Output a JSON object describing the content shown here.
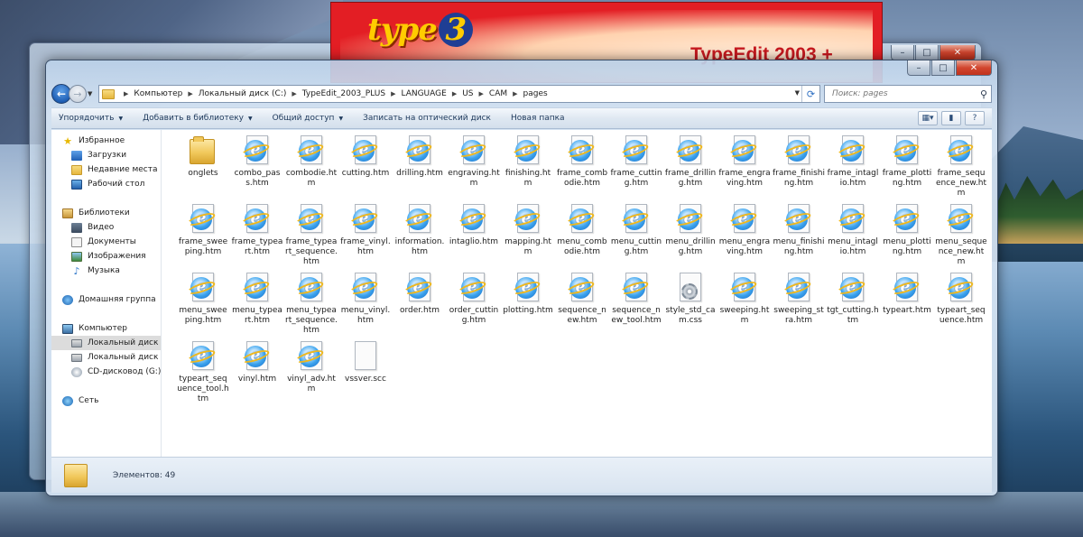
{
  "splash": {
    "logo_text": "type",
    "logo_number": "3",
    "product_title": "TypeEdit 2003 +"
  },
  "address": {
    "crumbs": [
      "Компьютер",
      "Локальный диск (C:)",
      "TypeEdit_2003_PLUS",
      "LANGUAGE",
      "US",
      "CAM",
      "pages"
    ]
  },
  "search": {
    "placeholder": "Поиск: pages"
  },
  "toolbar": {
    "organize": "Упорядочить",
    "add_to_library": "Добавить в библиотеку",
    "share": "Общий доступ",
    "burn": "Записать на оптический диск",
    "new_folder": "Новая папка"
  },
  "nav": {
    "favorites": "Избранное",
    "downloads": "Загрузки",
    "recent": "Недавние места",
    "desktop": "Рабочий стол",
    "libraries": "Библиотеки",
    "video": "Видео",
    "documents": "Документы",
    "images": "Изображения",
    "music": "Музыка",
    "homegroup": "Домашняя группа",
    "computer": "Компьютер",
    "drive_c": "Локальный диск (C",
    "drive_d": "Локальный диск (D",
    "drive_g": "CD-дисковод (G:)",
    "network": "Сеть"
  },
  "files": [
    {
      "name": "onglets",
      "type": "folder"
    },
    {
      "name": "combo_pass.htm",
      "type": "htm"
    },
    {
      "name": "combodie.htm",
      "type": "htm"
    },
    {
      "name": "cutting.htm",
      "type": "htm"
    },
    {
      "name": "drilling.htm",
      "type": "htm"
    },
    {
      "name": "engraving.htm",
      "type": "htm"
    },
    {
      "name": "finishing.htm",
      "type": "htm"
    },
    {
      "name": "frame_combodie.htm",
      "type": "htm"
    },
    {
      "name": "frame_cutting.htm",
      "type": "htm"
    },
    {
      "name": "frame_drilling.htm",
      "type": "htm"
    },
    {
      "name": "frame_engraving.htm",
      "type": "htm"
    },
    {
      "name": "frame_finishing.htm",
      "type": "htm"
    },
    {
      "name": "frame_intaglio.htm",
      "type": "htm"
    },
    {
      "name": "frame_plotting.htm",
      "type": "htm"
    },
    {
      "name": "frame_sequence_new.htm",
      "type": "htm"
    },
    {
      "name": "frame_sweeping.htm",
      "type": "htm"
    },
    {
      "name": "frame_typeart.htm",
      "type": "htm"
    },
    {
      "name": "frame_typeart_sequence.htm",
      "type": "htm"
    },
    {
      "name": "frame_vinyl.htm",
      "type": "htm"
    },
    {
      "name": "information.htm",
      "type": "htm"
    },
    {
      "name": "intaglio.htm",
      "type": "htm"
    },
    {
      "name": "mapping.htm",
      "type": "htm"
    },
    {
      "name": "menu_combodie.htm",
      "type": "htm"
    },
    {
      "name": "menu_cutting.htm",
      "type": "htm"
    },
    {
      "name": "menu_drilling.htm",
      "type": "htm"
    },
    {
      "name": "menu_engraving.htm",
      "type": "htm"
    },
    {
      "name": "menu_finishing.htm",
      "type": "htm"
    },
    {
      "name": "menu_intaglio.htm",
      "type": "htm"
    },
    {
      "name": "menu_plotting.htm",
      "type": "htm"
    },
    {
      "name": "menu_sequence_new.htm",
      "type": "htm"
    },
    {
      "name": "menu_sweeping.htm",
      "type": "htm"
    },
    {
      "name": "menu_typeart.htm",
      "type": "htm"
    },
    {
      "name": "menu_typeart_sequence.htm",
      "type": "htm"
    },
    {
      "name": "menu_vinyl.htm",
      "type": "htm"
    },
    {
      "name": "order.htm",
      "type": "htm"
    },
    {
      "name": "order_cutting.htm",
      "type": "htm"
    },
    {
      "name": "plotting.htm",
      "type": "htm"
    },
    {
      "name": "sequence_new.htm",
      "type": "htm"
    },
    {
      "name": "sequence_new_tool.htm",
      "type": "htm"
    },
    {
      "name": "style_std_cam.css",
      "type": "css"
    },
    {
      "name": "sweeping.htm",
      "type": "htm"
    },
    {
      "name": "sweeping_stra.htm",
      "type": "htm"
    },
    {
      "name": "tgt_cutting.htm",
      "type": "htm"
    },
    {
      "name": "typeart.htm",
      "type": "htm"
    },
    {
      "name": "typeart_sequence.htm",
      "type": "htm"
    },
    {
      "name": "typeart_sequence_tool.htm",
      "type": "htm"
    },
    {
      "name": "vinyl.htm",
      "type": "htm"
    },
    {
      "name": "vinyl_adv.htm",
      "type": "htm"
    },
    {
      "name": "vssver.scc",
      "type": "blank"
    }
  ],
  "status": {
    "item_count": "Элементов: 49"
  }
}
